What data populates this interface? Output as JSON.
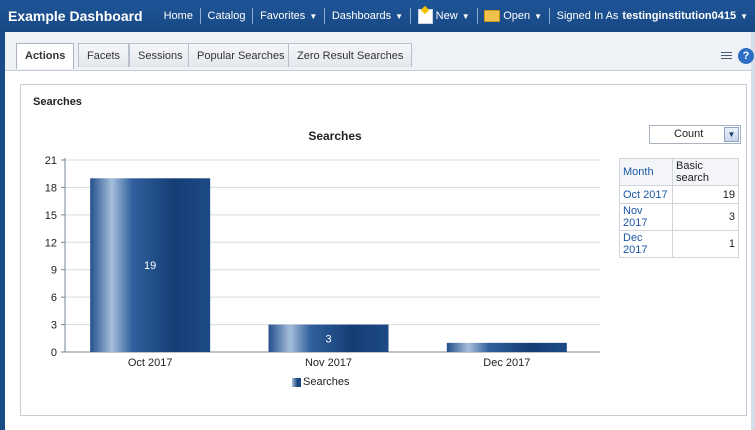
{
  "app": {
    "title": "Example Dashboard"
  },
  "nav": {
    "home": "Home",
    "catalog": "Catalog",
    "favorites": "Favorites",
    "dashboards": "Dashboards",
    "new": "New",
    "open": "Open",
    "signed_in_prefix": "Signed In As",
    "user": "testinginstitution0415"
  },
  "tabs": [
    {
      "label": "Actions",
      "active": true
    },
    {
      "label": "Facets",
      "active": false
    },
    {
      "label": "Sessions",
      "active": false
    },
    {
      "label": "Popular Searches",
      "active": false
    },
    {
      "label": "Zero Result Searches",
      "active": false
    }
  ],
  "section": {
    "title": "Searches"
  },
  "measure_select": {
    "value": "Count"
  },
  "table": {
    "headers": [
      "Month",
      "Basic search"
    ],
    "rows": [
      {
        "month": "Oct 2017",
        "value": "19"
      },
      {
        "month": "Nov 2017",
        "value": "3"
      },
      {
        "month": "Dec 2017",
        "value": "1"
      }
    ]
  },
  "chart_data": {
    "type": "bar",
    "title": "Searches",
    "categories": [
      "Oct 2017",
      "Nov 2017",
      "Dec 2017"
    ],
    "series": [
      {
        "name": "Searches",
        "values": [
          19,
          3,
          1
        ]
      }
    ],
    "data_labels": [
      "19",
      "3",
      ""
    ],
    "ylim": [
      0,
      21
    ],
    "yticks": [
      0,
      3,
      6,
      9,
      12,
      15,
      18,
      21
    ],
    "grid": true,
    "legend": "bottom"
  }
}
